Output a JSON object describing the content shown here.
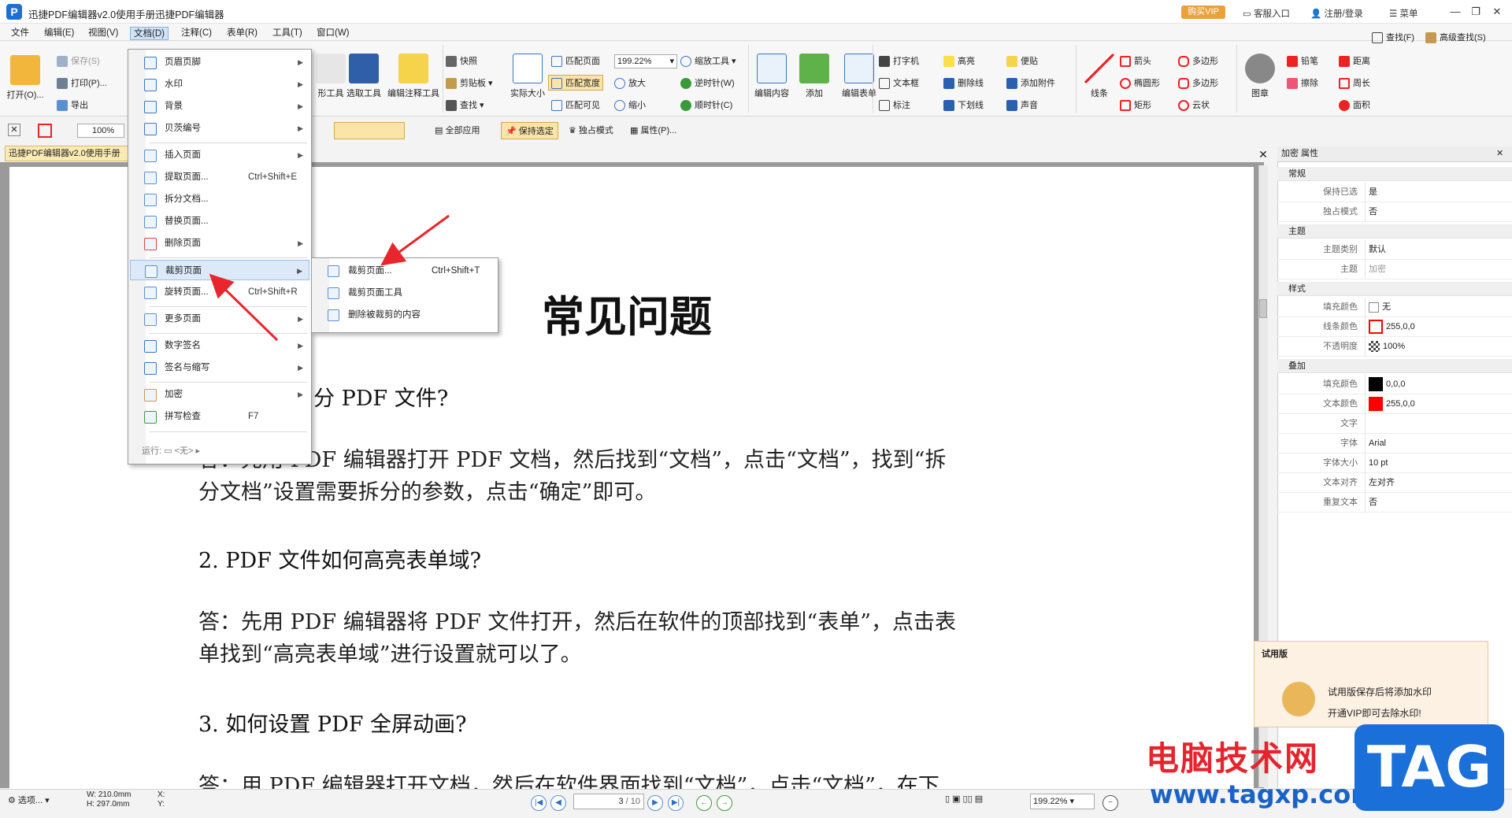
{
  "titlebar": {
    "title": "迅捷PDF编辑器v2.0使用手册迅捷PDF编辑器",
    "logo": "P",
    "vip": "购买VIP",
    "service": "客服入口",
    "login": "注册/登录",
    "menu": "菜单"
  },
  "menubar": [
    "文件",
    "编辑(E)",
    "视图(V)",
    "文档(D)",
    "注释(C)",
    "表单(R)",
    "工具(T)",
    "窗口(W)"
  ],
  "ribbon": {
    "open": "打开(O)...",
    "save": "保存(S)",
    "print": "打印(P)...",
    "export": "导出",
    "hand": "形工具",
    "select": "选取工具",
    "editnote": "编辑注释工具",
    "snapshot": "快照",
    "clipboard": "剪贴板",
    "find": "查找",
    "actual": "实际大小",
    "fitpage": "匹配页面",
    "fitwidth": "匹配宽度",
    "fitvisible": "匹配可见",
    "zoom": "199.22%",
    "zoomtool": "缩放工具",
    "zoomin": "放大",
    "zoomout": "缩小",
    "ccw": "逆时针(W)",
    "cw": "顺时针(C)",
    "editcontent": "编辑内容",
    "add": "添加",
    "editform": "编辑表单",
    "typewriter": "打字机",
    "textbox": "文本框",
    "callout": "标注",
    "highlight": "高亮",
    "strike": "删除线",
    "underline": "下划线",
    "note": "便贴",
    "attach": "添加附件",
    "sound": "声音",
    "line": "线条",
    "arrow": "箭头",
    "ellipse": "椭圆形",
    "rect": "矩形",
    "polygon": "多边形",
    "polyline": "多边形",
    "cloud": "云状",
    "stamp": "图章",
    "pencil": "铅笔",
    "eraser": "擦除",
    "distance": "距离",
    "perimeter": "周长",
    "area": "面积",
    "search": "查找(F)",
    "advsearch": "高级查找(S)"
  },
  "toolbar2": {
    "opacity": "100%",
    "applyall": "全部应用",
    "keepselect": "保持选定",
    "exclusive": "独占模式",
    "props": "属性(P)..."
  },
  "doctab": "迅捷PDF编辑器v2.0使用手册",
  "document": {
    "title": "常见问题",
    "q1": "分 PDF 文件?",
    "a1l1": "答：先用 PDF 编辑器打开 PDF 文档，然后找到“文档”，点击“文档”，找到“拆",
    "a1l2": "分文档”设置需要拆分的参数，点击“确定”即可。",
    "q2": "2. PDF 文件如何高亮表单域?",
    "a2l1": "答：先用 PDF 编辑器将 PDF 文件打开，然后在软件的顶部找到“表单”，点击表",
    "a2l2": "单找到“高亮表单域”进行设置就可以了。",
    "q3": "3. 如何设置 PDF 全屏动画?",
    "a3l1": "答：用 PDF 编辑器打开文档，然后在软件界面找到“文档”，点击“文档”，在下"
  },
  "dropdown": {
    "items": [
      {
        "label": "页眉页脚",
        "arrow": "▶"
      },
      {
        "label": "水印",
        "arrow": "▶"
      },
      {
        "label": "背景",
        "arrow": "▶"
      },
      {
        "label": "贝茨编号",
        "arrow": "▶"
      },
      {
        "label": "插入页面",
        "arrow": "▶"
      },
      {
        "label": "提取页面...",
        "shortcut": "Ctrl+Shift+E"
      },
      {
        "label": "拆分文档..."
      },
      {
        "label": "替换页面..."
      },
      {
        "label": "删除页面",
        "arrow": "▶"
      },
      {
        "label": "裁剪页面",
        "arrow": "▶"
      },
      {
        "label": "旋转页面...",
        "shortcut": "Ctrl+Shift+R"
      },
      {
        "label": "更多页面",
        "arrow": "▶"
      },
      {
        "label": "数字签名",
        "arrow": "▶"
      },
      {
        "label": "签名与缩写",
        "arrow": "▶"
      },
      {
        "label": "加密",
        "arrow": "▶"
      },
      {
        "label": "拼写检查",
        "shortcut": "F7"
      }
    ],
    "run": "运行:",
    "run_value": "<无>"
  },
  "submenu": [
    {
      "label": "裁剪页面...",
      "shortcut": "Ctrl+Shift+T"
    },
    {
      "label": "裁剪页面工具"
    },
    {
      "label": "删除被裁剪的内容"
    }
  ],
  "panel": {
    "title": "加密 属性",
    "groups": {
      "general": "常规",
      "theme": "主题",
      "style": "样式",
      "overlay": "叠加"
    },
    "rows": {
      "keep": {
        "k": "保持已选",
        "v": "是"
      },
      "exclusive": {
        "k": "独占模式",
        "v": "否"
      },
      "themecat": {
        "k": "主题类别",
        "v": "默认"
      },
      "theme": {
        "k": "主题",
        "v": "加密"
      },
      "fill": {
        "k": "填充颜色",
        "v": "无"
      },
      "stroke": {
        "k": "线条颜色",
        "v": "255,0,0"
      },
      "opacity": {
        "k": "不透明度",
        "v": "100%"
      },
      "ofill": {
        "k": "填充颜色",
        "v": "0,0,0"
      },
      "otext": {
        "k": "文本颜色",
        "v": "255,0,0"
      },
      "text": {
        "k": "文字",
        "v": ""
      },
      "font": {
        "k": "字体",
        "v": "Arial"
      },
      "fontsize": {
        "k": "字体大小",
        "v": "10 pt"
      },
      "align": {
        "k": "文本对齐",
        "v": "左对齐"
      },
      "repeat": {
        "k": "重复文本",
        "v": "否"
      }
    },
    "colors": {
      "stroke": "#ff0000",
      "ofill": "#000000",
      "otext": "#ff0000"
    }
  },
  "trial": {
    "title": "试用版",
    "line1": "试用版保存后将添加水印",
    "line2": "开通VIP即可去除水印!"
  },
  "status": {
    "options": "选项...",
    "w": "W: 210.0mm",
    "h": "H: 297.0mm",
    "x": "X:",
    "y": "Y:",
    "page": "3",
    "pages": "/ 10",
    "zoom": "199.22%"
  },
  "watermark": {
    "text": "电脑技术网",
    "url": "www.tagxp.com",
    "tag": "TAG"
  }
}
